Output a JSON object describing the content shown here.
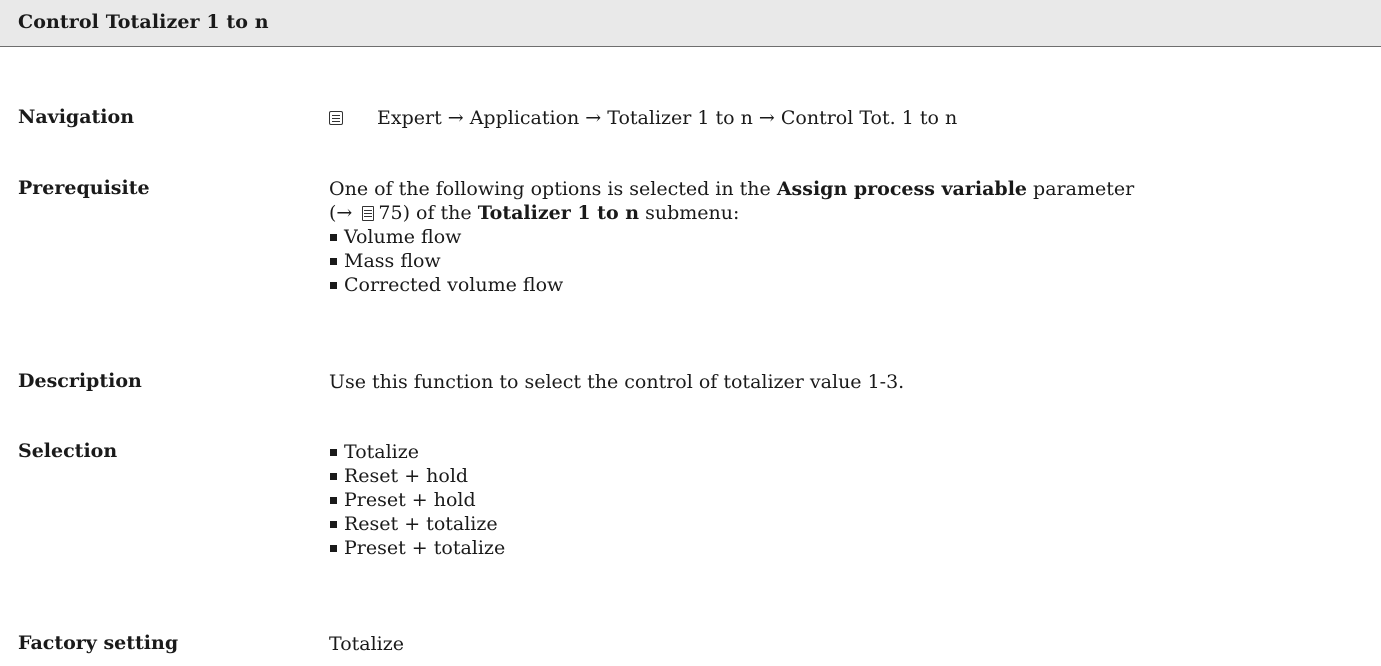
{
  "header": {
    "title": "Control Totalizer 1 to n"
  },
  "navigation": {
    "label": "Navigation",
    "icon": "menu-path-icon",
    "path": "Expert → Application → Totalizer 1 to n → Control Tot. 1 to n"
  },
  "prerequisite": {
    "label": "Prerequisite",
    "line1_pre": "One of the following options is selected in the ",
    "line1_bold": "Assign process variable",
    "line1_post": " parameter",
    "line2_pre": "(→ ",
    "page_icon": "page-reference-icon",
    "page_ref": "75",
    "line2_mid": ") of the ",
    "line2_bold": "Totalizer 1 to n",
    "line2_post": " submenu:",
    "options": [
      "Volume flow",
      "Mass flow",
      "Corrected volume flow"
    ]
  },
  "description": {
    "label": "Description",
    "text": "Use this function to select the control of totalizer value 1-3."
  },
  "selection": {
    "label": "Selection",
    "options": [
      "Totalize",
      "Reset + hold",
      "Preset + hold",
      "Reset + totalize",
      "Preset + totalize"
    ]
  },
  "factory_setting": {
    "label": "Factory setting",
    "value": "Totalize"
  }
}
